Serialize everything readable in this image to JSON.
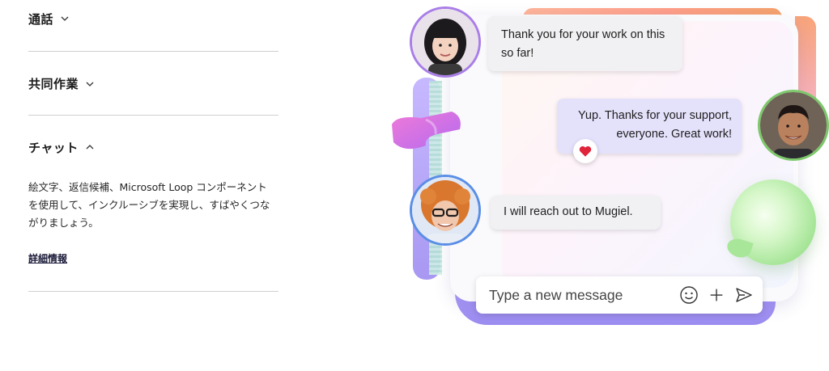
{
  "accordion": {
    "sections": [
      {
        "title": "通話",
        "state": "collapsed",
        "chevron": "chevron-down-icon"
      },
      {
        "title": "共同作業",
        "state": "collapsed",
        "chevron": "chevron-down-icon"
      },
      {
        "title": "チャット",
        "state": "expanded",
        "chevron": "chevron-up-icon",
        "body": "絵文字、返信候補、Microsoft Loop コンポーネントを使用して、インクルーシブを実現し、すばやくつながりましょう。",
        "link": "詳細情報"
      }
    ]
  },
  "chat": {
    "messages": [
      {
        "text": "Thank you for your work on this so far!",
        "side": "left",
        "avatar": "avatar-woman"
      },
      {
        "text": "Yup. Thanks for your support, everyone. Great work!",
        "side": "right",
        "avatar": "avatar-man",
        "reaction": "heart-icon"
      },
      {
        "text": "I will reach out to Mugiel.",
        "side": "left",
        "avatar": "avatar-curly-hair-man"
      }
    ],
    "composer": {
      "placeholder": "Type a new message",
      "icons": [
        "emoji-icon",
        "plus-icon",
        "send-icon"
      ]
    }
  },
  "colors": {
    "accent_purple": "#a898f2",
    "bubble_purple": "#e4e1fb",
    "heart_red": "#e0243a",
    "balloon_green": "#a8e69a"
  }
}
